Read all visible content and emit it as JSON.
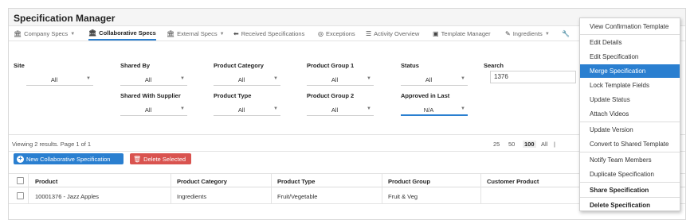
{
  "app": {
    "title": "Specification Manager"
  },
  "nav": {
    "tabs": [
      {
        "label": "Company Specs",
        "icon": "bank-icon",
        "caret": true,
        "active": false
      },
      {
        "label": "Collaborative Specs",
        "icon": "bank-icon",
        "caret": false,
        "active": true
      },
      {
        "label": "External Specs",
        "icon": "bank-icon",
        "caret": true,
        "active": false
      },
      {
        "label": "Received Specifications",
        "icon": "arrow-left-icon",
        "caret": false,
        "active": false
      },
      {
        "label": "Exceptions",
        "icon": "clock-icon",
        "caret": false,
        "active": false
      },
      {
        "label": "Activity Overview",
        "icon": "list-icon",
        "caret": false,
        "active": false
      },
      {
        "label": "Template Manager",
        "icon": "template-icon",
        "caret": false,
        "active": false
      },
      {
        "label": "Ingredients",
        "icon": "leaf-icon",
        "caret": true,
        "active": false
      }
    ]
  },
  "filters": {
    "site": {
      "label": "Site",
      "value": "All"
    },
    "shared_by": {
      "label": "Shared By",
      "value": "All"
    },
    "product_category": {
      "label": "Product Category",
      "value": "All"
    },
    "product_group_1": {
      "label": "Product Group 1",
      "value": "All"
    },
    "status": {
      "label": "Status",
      "value": "All"
    },
    "search": {
      "label": "Search",
      "value": "1376"
    },
    "shared_with_supplier": {
      "label": "Shared With Supplier",
      "value": "All"
    },
    "product_type": {
      "label": "Product Type",
      "value": "All"
    },
    "product_group_2": {
      "label": "Product Group 2",
      "value": "All"
    },
    "approved_in_last": {
      "label": "Approved in Last",
      "value": "N/A"
    }
  },
  "pager": {
    "viewing": "Viewing 2 results. Page 1 of 1",
    "sizes": [
      "25",
      "50",
      "100",
      "All",
      "|"
    ],
    "selected": "100"
  },
  "actions": {
    "new_label": "New Collaborative Specification",
    "delete_label": "Delete Selected"
  },
  "table": {
    "headers": [
      "Product",
      "Product Category",
      "Product Type",
      "Product Group",
      "Customer Product"
    ],
    "rows": [
      {
        "product": "10001376 - Jazz Apples",
        "category": "Ingredients",
        "type": "Fruit/Vegetable",
        "group": "Fruit & Veg",
        "customer": ""
      }
    ]
  },
  "menu": {
    "items": [
      {
        "label": "View Confirmation Template",
        "highlight": false,
        "bold": false
      },
      {
        "label": "Edit Details",
        "highlight": false,
        "bold": false
      },
      {
        "label": "Edit Specification",
        "highlight": false,
        "bold": false
      },
      {
        "label": "Merge Specification",
        "highlight": true,
        "bold": false
      },
      {
        "label": "Lock Template Fields",
        "highlight": false,
        "bold": false
      },
      {
        "label": "Update Status",
        "highlight": false,
        "bold": false
      },
      {
        "label": "Attach Videos",
        "highlight": false,
        "bold": false
      },
      {
        "label": "Update Version",
        "highlight": false,
        "bold": false
      },
      {
        "label": "Convert to Shared Template",
        "highlight": false,
        "bold": false
      },
      {
        "label": "Notify Team Members",
        "highlight": false,
        "bold": false
      },
      {
        "label": "Duplicate Specification",
        "highlight": false,
        "bold": false
      },
      {
        "label": "Share Specification",
        "highlight": false,
        "bold": true
      },
      {
        "label": "Delete Specification",
        "highlight": false,
        "bold": true
      }
    ]
  },
  "colors": {
    "accent": "#2a7fd0",
    "danger": "#d9534f",
    "menu_highlight": "#2a7fd0"
  }
}
